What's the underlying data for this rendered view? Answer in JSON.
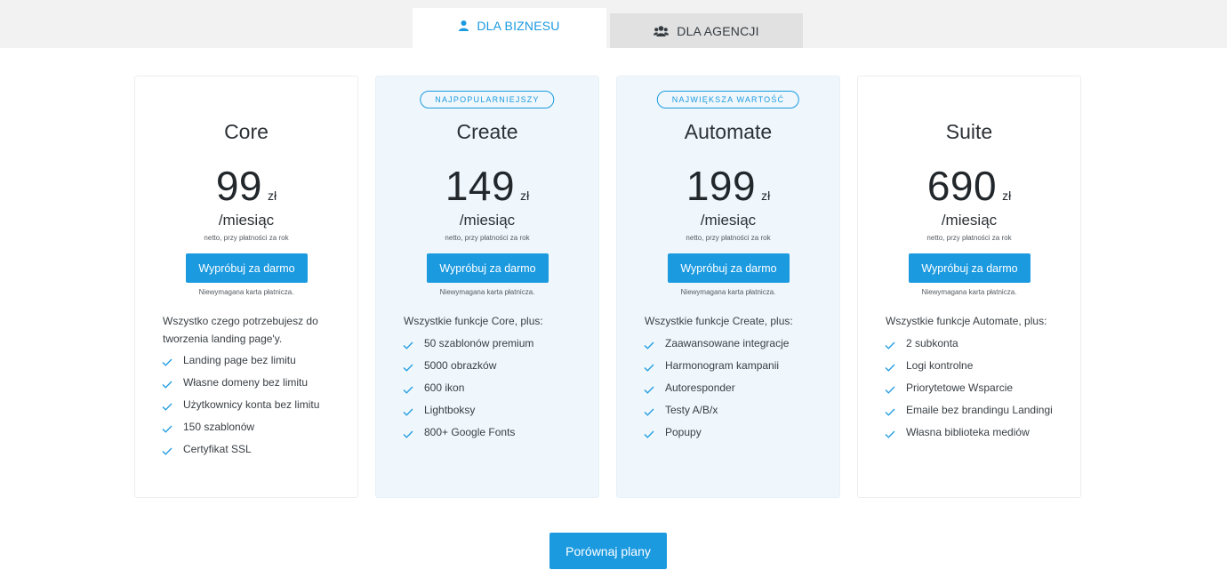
{
  "tabs": {
    "business": "DLA BIZNESU",
    "agency": "DLA AGENCJI"
  },
  "colors": {
    "accent": "#1b9ae0",
    "highlight_card_bg": "#eff7fc",
    "top_band": "#f2f2f2"
  },
  "plans": [
    {
      "name": "Core",
      "badge": "",
      "price": "99",
      "currency": "zł",
      "period": "/miesiąc",
      "note": "netto, przy płatności za rok",
      "cta": "Wypróbuj za darmo",
      "card_note": "Niewymagana karta płatnicza.",
      "intro": "Wszystko czego potrzebujesz do tworzenia landing page'y.",
      "features": [
        "Landing page bez limitu",
        "Własne domeny bez limitu",
        "Użytkownicy konta bez limitu",
        "150 szablonów",
        "Certyfikat SSL"
      ]
    },
    {
      "name": "Create",
      "badge": "NAJPOPULARNIEJSZY",
      "price": "149",
      "currency": "zł",
      "period": "/miesiąc",
      "note": "netto, przy płatności za rok",
      "cta": "Wypróbuj za darmo",
      "card_note": "Niewymagana karta płatnicza.",
      "intro": "Wszystkie funkcje Core, plus:",
      "features": [
        "50 szablonów premium",
        "5000 obrazków",
        "600 ikon",
        "Lightboksy",
        "800+ Google Fonts"
      ]
    },
    {
      "name": "Automate",
      "badge": "NAJWIĘKSZA WARTOŚĆ",
      "price": "199",
      "currency": "zł",
      "period": "/miesiąc",
      "note": "netto, przy płatności za rok",
      "cta": "Wypróbuj za darmo",
      "card_note": "Niewymagana karta płatnicza.",
      "intro": "Wszystkie funkcje Create, plus:",
      "features": [
        "Zaawansowane integracje",
        "Harmonogram kampanii",
        "Autoresponder",
        "Testy A/B/x",
        "Popupy"
      ]
    },
    {
      "name": "Suite",
      "badge": "",
      "price": "690",
      "currency": "zł",
      "period": "/miesiąc",
      "note": "netto, przy płatności za rok",
      "cta": "Wypróbuj za darmo",
      "card_note": "Niewymagana karta płatnicza.",
      "intro": "Wszystkie funkcje Automate, plus:",
      "features": [
        "2 subkonta",
        "Logi kontrolne",
        "Priorytetowe Wsparcie",
        "Emaile bez brandingu Landingi",
        "Własna biblioteka mediów"
      ]
    }
  ],
  "compare": "Porównaj plany",
  "icons": {
    "business_tab": "user-icon",
    "agency_tab": "users-icon",
    "feature": "check-icon"
  }
}
